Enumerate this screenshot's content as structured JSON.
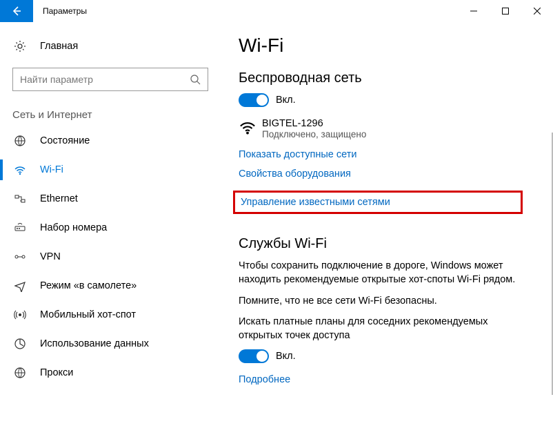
{
  "window": {
    "title": "Параметры"
  },
  "sidebar": {
    "home": "Главная",
    "search_placeholder": "Найти параметр",
    "section": "Сеть и Интернет",
    "items": [
      {
        "label": "Состояние"
      },
      {
        "label": "Wi-Fi"
      },
      {
        "label": "Ethernet"
      },
      {
        "label": "Набор номера"
      },
      {
        "label": "VPN"
      },
      {
        "label": "Режим «в самолете»"
      },
      {
        "label": "Мобильный хот-спот"
      },
      {
        "label": "Использование данных"
      },
      {
        "label": "Прокси"
      }
    ]
  },
  "content": {
    "page_title": "Wi-Fi",
    "wireless_heading": "Беспроводная сеть",
    "wireless_toggle_label": "Вкл.",
    "network": {
      "name": "BIGTEL-1296",
      "status": "Подключено, защищено"
    },
    "link_show_available": "Показать доступные сети",
    "link_hw_props": "Свойства оборудования",
    "link_known_nets": "Управление известными сетями",
    "services_heading": "Службы Wi-Fi",
    "services_body1": "Чтобы сохранить подключение в дороге, Windows может находить рекомендуемые открытые хот-споты Wi-Fi рядом.",
    "services_body2": "Помните, что не все сети Wi-Fi безопасны.",
    "services_body3": "Искать платные планы для соседних рекомендуемых открытых точек доступа",
    "services_toggle_label": "Вкл.",
    "link_more": "Подробнее"
  }
}
